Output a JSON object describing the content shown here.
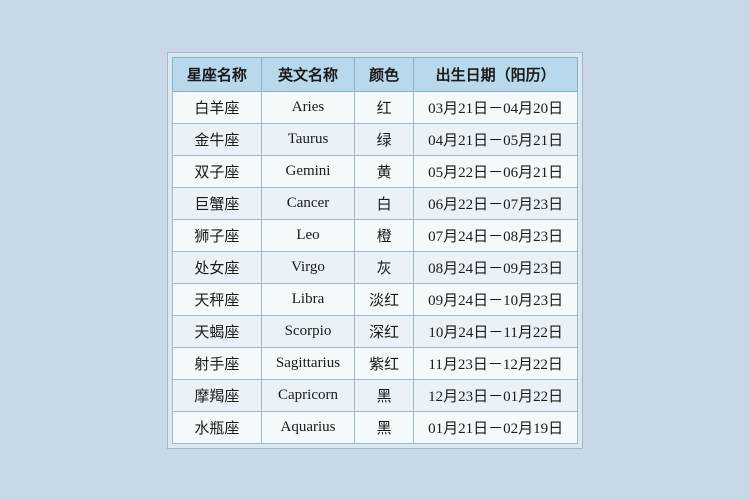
{
  "table": {
    "headers": [
      "星座名称",
      "英文名称",
      "颜色",
      "出生日期（阳历）"
    ],
    "rows": [
      [
        "白羊座",
        "Aries",
        "红",
        "03月21日－04月20日"
      ],
      [
        "金牛座",
        "Taurus",
        "绿",
        "04月21日－05月21日"
      ],
      [
        "双子座",
        "Gemini",
        "黄",
        "05月22日－06月21日"
      ],
      [
        "巨蟹座",
        "Cancer",
        "白",
        "06月22日－07月23日"
      ],
      [
        "狮子座",
        "Leo",
        "橙",
        "07月24日－08月23日"
      ],
      [
        "处女座",
        "Virgo",
        "灰",
        "08月24日－09月23日"
      ],
      [
        "天秤座",
        "Libra",
        "淡红",
        "09月24日－10月23日"
      ],
      [
        "天蝎座",
        "Scorpio",
        "深红",
        "10月24日－11月22日"
      ],
      [
        "射手座",
        "Sagittarius",
        "紫红",
        "11月23日－12月22日"
      ],
      [
        "摩羯座",
        "Capricorn",
        "黑",
        "12月23日－01月22日"
      ],
      [
        "水瓶座",
        "Aquarius",
        "黑",
        "01月21日－02月19日"
      ]
    ]
  }
}
